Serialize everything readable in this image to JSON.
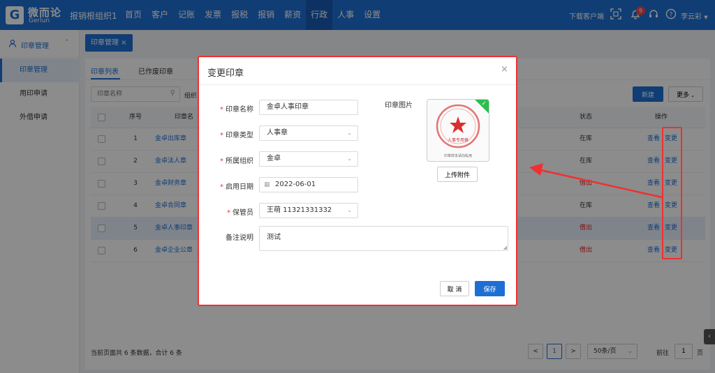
{
  "brand": {
    "name": "微而论",
    "sub": "Gerlun",
    "mark": "G"
  },
  "header": {
    "org": "报销根组织1",
    "nav": [
      "首页",
      "客户",
      "记账",
      "发票",
      "报税",
      "报销",
      "薪资",
      "行政",
      "人事",
      "设置"
    ],
    "active_nav": "行政",
    "download": "下载客户端",
    "notification_count": "9",
    "user": "李云彩",
    "icons": [
      "scan-icon",
      "bell-icon",
      "headset-icon",
      "help-icon",
      "chevron-down-icon"
    ]
  },
  "sidebar": {
    "section": "印章管理",
    "items": [
      "印章管理",
      "用印申请",
      "外借申请"
    ]
  },
  "tabbar": {
    "tab": "印章管理 ×"
  },
  "page": {
    "subtabs": [
      "印章列表",
      "已作废印章"
    ],
    "search_placeholder": "印章名称",
    "filter_label": "组织",
    "new_label": "新建",
    "more_label": "更多",
    "columns": [
      "序号",
      "印章名",
      "状态",
      "操作"
    ],
    "rows": [
      {
        "no": "1",
        "name": "金卓出库章",
        "status": "在库",
        "status_color": "#333333"
      },
      {
        "no": "2",
        "name": "金卓法人章",
        "status": "在库",
        "status_color": "#333333"
      },
      {
        "no": "3",
        "name": "金卓财务章",
        "status": "借出",
        "status_color": "#e02020"
      },
      {
        "no": "4",
        "name": "金卓合同章",
        "status": "在库",
        "status_color": "#333333"
      },
      {
        "no": "5",
        "name": "金卓人事印章",
        "status": "借出",
        "status_color": "#e02020"
      },
      {
        "no": "6",
        "name": "金卓企业公章",
        "status": "借出",
        "status_color": "#e02020"
      }
    ],
    "action_view": "查看",
    "action_change": "变更"
  },
  "pager": {
    "summary": "当前页面共 6 条数据，合计 6 条",
    "prev": "<",
    "current": "1",
    "next": ">",
    "page_size": "50条/页",
    "goto_label": "前往",
    "goto_value": "1",
    "page_unit": "页"
  },
  "modal": {
    "title": "变更印章",
    "close": "×",
    "fields": {
      "name_label": "印章名称",
      "name_value": "金卓人事印章",
      "type_label": "印章类型",
      "type_value": "人事章",
      "org_label": "所属组织",
      "org_value": "金卓",
      "date_label": "启用日期",
      "date_value": "2022-06-01",
      "keeper_label": "保管员",
      "keeper_value": "王萌 11321331332",
      "remark_label": "备注说明",
      "remark_value": "测试"
    },
    "image_label": "印章图片",
    "stamp_text": "人事专用章",
    "image_caption": "印章样本请勿乱用",
    "upload_label": "上传附件",
    "cancel_label": "取 消",
    "save_label": "保存"
  },
  "colors": {
    "brand": "#1e6fd4",
    "annotation": "#f03030",
    "success": "#2bbd4e"
  }
}
